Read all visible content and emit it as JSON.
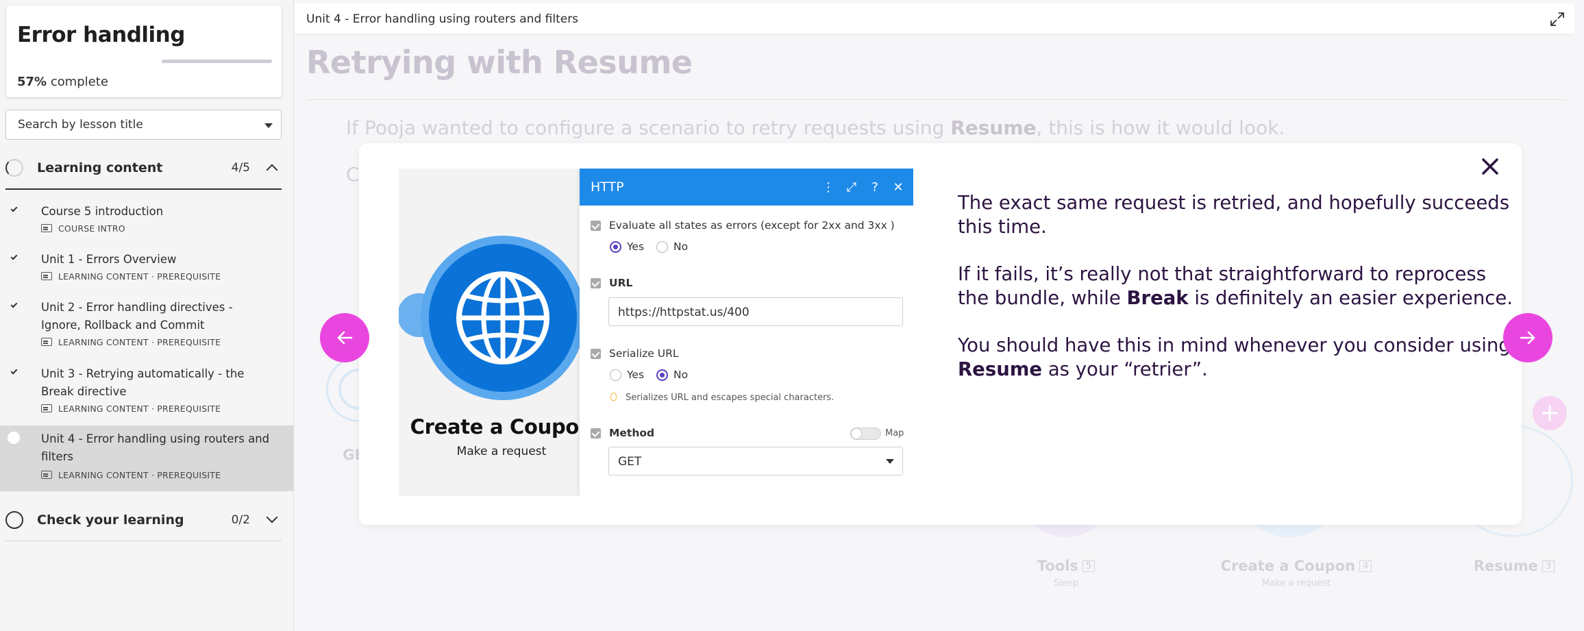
{
  "sidebar": {
    "course": {
      "title": "Error handling",
      "percent": "57%",
      "percent_suffix": " complete",
      "progress": 0.57
    },
    "search": {
      "placeholder": "Search by lesson title"
    },
    "sections": [
      {
        "label": "Learning content",
        "count": "4/5",
        "expanded": true
      },
      {
        "label": "Check your learning",
        "count": "0/2",
        "expanded": false
      }
    ],
    "lessons": [
      {
        "title": "Course 5 introduction",
        "meta": "COURSE INTRO",
        "completed": true
      },
      {
        "title": "Unit 1 - Errors Overview",
        "meta": "LEARNING CONTENT · PREREQUISITE",
        "completed": true
      },
      {
        "title": "Unit 2 - Error handling directives - Ignore, Rollback and Commit",
        "meta": "LEARNING CONTENT · PREREQUISITE",
        "completed": true
      },
      {
        "title": "Unit 3 - Retrying automatically - the Break directive",
        "meta": "LEARNING CONTENT · PREREQUISITE",
        "completed": true
      },
      {
        "title": "Unit 4 - Error handling using routers and filters",
        "meta": "LEARNING CONTENT · PREREQUISITE",
        "completed": false,
        "active": true
      }
    ]
  },
  "main": {
    "breadcrumb": "Unit 4 - Error handling using routers and filters",
    "heading": "Retrying with Resume",
    "intro_pre": "If Pooja wanted to configure a scenario to retry requests using ",
    "intro_bold": "Resume",
    "intro_post": ", this is how it would look.",
    "bg_fragment": "C",
    "background_diagram": {
      "left_label": "GE",
      "nodes": [
        {
          "label": "Tools",
          "badge": "5",
          "sub": "Sleep"
        },
        {
          "label": "Create a Coupon",
          "badge": "4",
          "sub": "Make a request"
        },
        {
          "label": "Resume",
          "badge": "3",
          "sub": ""
        }
      ]
    }
  },
  "modal": {
    "paragraphs": [
      {
        "text": "The exact same request is retried, and hopefully succeeds this time."
      },
      {
        "pre": "If it fails, it’s really not that straightforward to reprocess the bundle, while ",
        "bold": "Break",
        "post": " is definitely an easier experience."
      },
      {
        "pre": "You should have this in mind whenever you consider using ",
        "bold": "Resume",
        "post": " as your “retrier”."
      }
    ],
    "screenshot": {
      "module_title": "Create a Coupon",
      "module_sub": "Make a request",
      "panel": {
        "title": "HTTP",
        "evaluate_label": "Evaluate all states as errors (except for 2xx and 3xx )",
        "yes": "Yes",
        "no": "No",
        "url_label": "URL",
        "url_value": "https://httpstat.us/400",
        "serialize_label": "Serialize URL",
        "serialize_hint": "Serializes URL and escapes special characters.",
        "method_label": "Method",
        "map_label": "Map",
        "method_value": "GET"
      }
    }
  },
  "colors": {
    "accent": "#e946e0",
    "modal_text": "#2c1441",
    "http_blue": "#1e8ae8",
    "radio_purple": "#5c3fc4"
  }
}
